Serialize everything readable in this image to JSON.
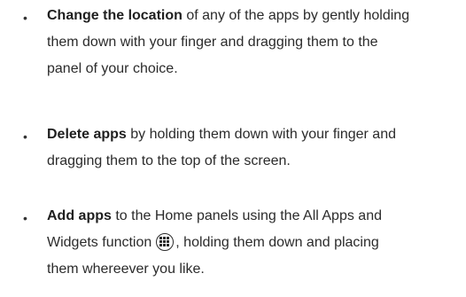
{
  "bullet_char": "•",
  "tips": [
    {
      "bold": "Change the location",
      "lines": [
        " of any of the apps by gently holding",
        "them down with your finger and dragging them to the",
        "panel of your choice."
      ]
    },
    {
      "bold": "Delete apps",
      "lines": [
        " by holding them down with your finger and",
        "dragging them to the top of the screen."
      ]
    },
    {
      "bold": "Add apps",
      "lines": [
        " to the Home panels using the All Apps and",
        "Widgets function",
        ", holding them down and placing",
        "them whereever you like."
      ],
      "icon": "all-apps-icon"
    }
  ]
}
